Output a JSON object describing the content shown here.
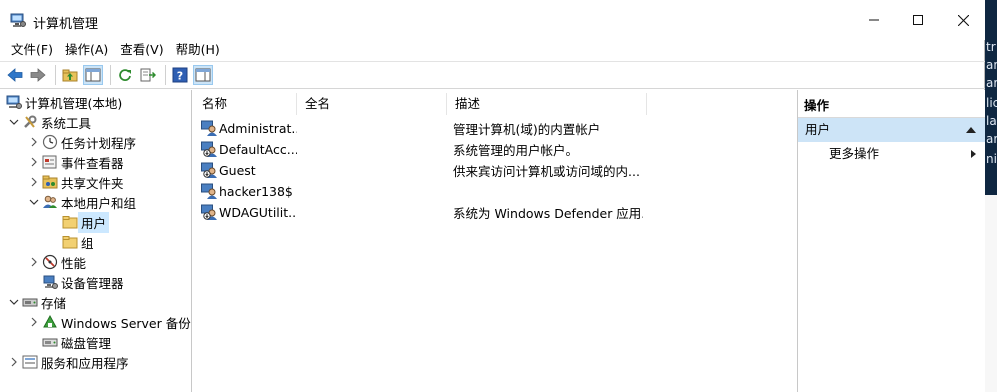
{
  "window": {
    "title": "计算机管理"
  },
  "menu": [
    "文件(F)",
    "操作(A)",
    "查看(V)",
    "帮助(H)"
  ],
  "tree": {
    "root": "计算机管理(本地)",
    "system_tools": "系统工具",
    "task_scheduler": "任务计划程序",
    "event_viewer": "事件查看器",
    "shared_folders": "共享文件夹",
    "local_users_groups": "本地用户和组",
    "users": "用户",
    "groups": "组",
    "performance": "性能",
    "device_manager": "设备管理器",
    "storage": "存储",
    "windows_server_backup": "Windows Server 备份",
    "disk_management": "磁盘管理",
    "services_apps": "服务和应用程序"
  },
  "list": {
    "headers": {
      "name": "名称",
      "fullname": "全名",
      "description": "描述"
    },
    "rows": [
      {
        "name": "Administrat...",
        "fullname": "",
        "description": "管理计算机(域)的内置帐户"
      },
      {
        "name": "DefaultAcc...",
        "fullname": "",
        "description": "系统管理的用户帐户。"
      },
      {
        "name": "Guest",
        "fullname": "",
        "description": "供来宾访问计算机或访问域的内..."
      },
      {
        "name": "hacker138$",
        "fullname": "",
        "description": ""
      },
      {
        "name": "WDAGUtilit...",
        "fullname": "",
        "description": "系统为 Windows Defender 应用..."
      }
    ]
  },
  "actions": {
    "header": "操作",
    "section": "用户",
    "more": "更多操作"
  },
  "desktop_text": [
    "tr",
    "an",
    "ar",
    "lic",
    "la",
    "ar",
    "nit"
  ],
  "colors": {
    "selection": "#cce8ff",
    "action_section_bg": "#cde4f7",
    "nav_arrow": "#2f77c9"
  }
}
